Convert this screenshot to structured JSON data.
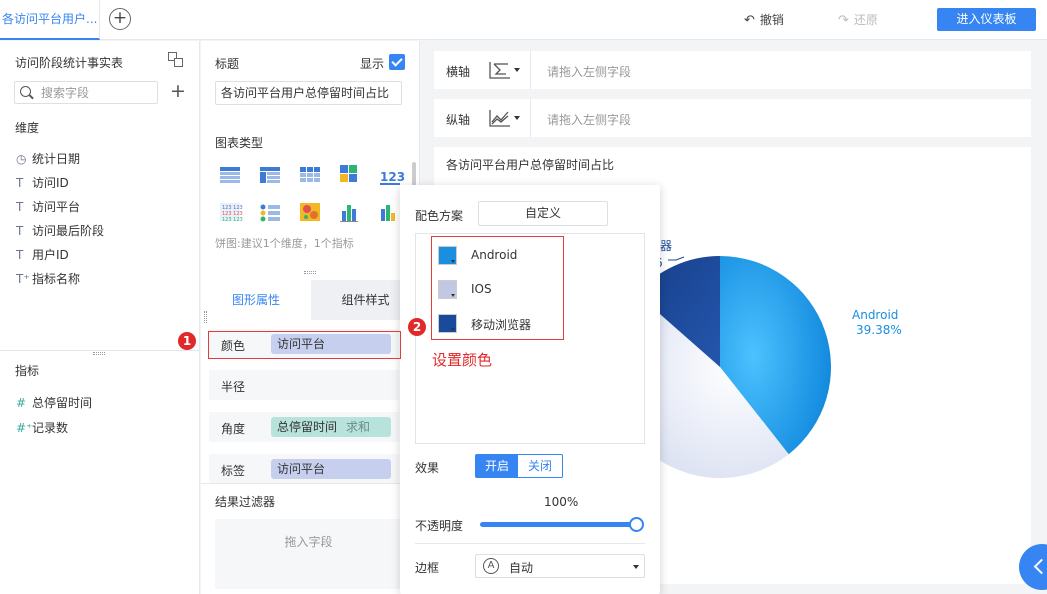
{
  "topbar": {
    "tab_label": "各访问平台用户...",
    "undo_label": "撤销",
    "redo_label": "还原",
    "enter_dashboard_label": "进入仪表板"
  },
  "data_panel": {
    "dataset_title": "访问阶段统计事实表",
    "search_placeholder": "搜索字段",
    "dimensions_label": "维度",
    "dimensions": [
      {
        "icon": "clock-icon",
        "label": "统计日期"
      },
      {
        "icon": "text-type-icon",
        "label": "访问ID"
      },
      {
        "icon": "text-type-icon",
        "label": "访问平台"
      },
      {
        "icon": "text-type-icon",
        "label": "访问最后阶段"
      },
      {
        "icon": "text-type-icon",
        "label": "用户ID"
      },
      {
        "icon": "text-type-icon",
        "label": "指标名称"
      }
    ],
    "measures_label": "指标",
    "measures": [
      {
        "icon": "hash-icon",
        "label": "总停留时间"
      },
      {
        "icon": "hash-icon",
        "label": "记录数"
      }
    ]
  },
  "config_panel": {
    "title_label": "标题",
    "show_label": "显示",
    "title_value": "各访问平台用户总停留时间占比",
    "chart_type_label": "图表类型",
    "chart_type_hint": "饼图:建议1个维度，1个指标",
    "tabs": {
      "graph_props": "图形属性",
      "component_style": "组件样式"
    },
    "props": {
      "color_label": "颜色",
      "color_field": "访问平台",
      "radius_label": "半径",
      "angle_label": "角度",
      "angle_field": "总停留时间",
      "angle_agg": "求和",
      "label_label": "标签",
      "label_field": "访问平台"
    },
    "filter_label": "结果过滤器",
    "filter_drop_hint": "拖入字段"
  },
  "axes": {
    "x_label": "横轴",
    "y_label": "纵轴",
    "placeholder": "请拖入左侧字段"
  },
  "chart": {
    "title": "各访问平台用户总停留时间占比"
  },
  "chart_data": {
    "type": "pie",
    "slices": [
      {
        "name": "Android",
        "value": 39.38,
        "label": "Android",
        "pct_label": "39.38%",
        "color": "#1a8fe0"
      },
      {
        "name": "IOS",
        "value": 47.12,
        "color": "#dde3f1"
      },
      {
        "name": "移动浏览器",
        "value": 13.5,
        "label_partial": "器",
        "pct_partial": "6",
        "color": "#1a4a9b"
      }
    ]
  },
  "popover": {
    "scheme_label": "配色方案",
    "scheme_value": "自定义",
    "colors": [
      {
        "label": "Android",
        "color": "#1a8fe0"
      },
      {
        "label": "IOS",
        "color": "#c1c8e4"
      },
      {
        "label": "移动浏览器",
        "color": "#1a4a9b"
      }
    ],
    "effect_label": "效果",
    "effect_on": "开启",
    "effect_off": "关闭",
    "opacity_label": "不透明度",
    "opacity_value": "100%",
    "opacity_fraction": 1.0,
    "border_label": "边框",
    "border_value": "自动"
  },
  "annotations": {
    "badge_1": "1",
    "badge_2": "2",
    "set_color_note": "设置颜色"
  }
}
